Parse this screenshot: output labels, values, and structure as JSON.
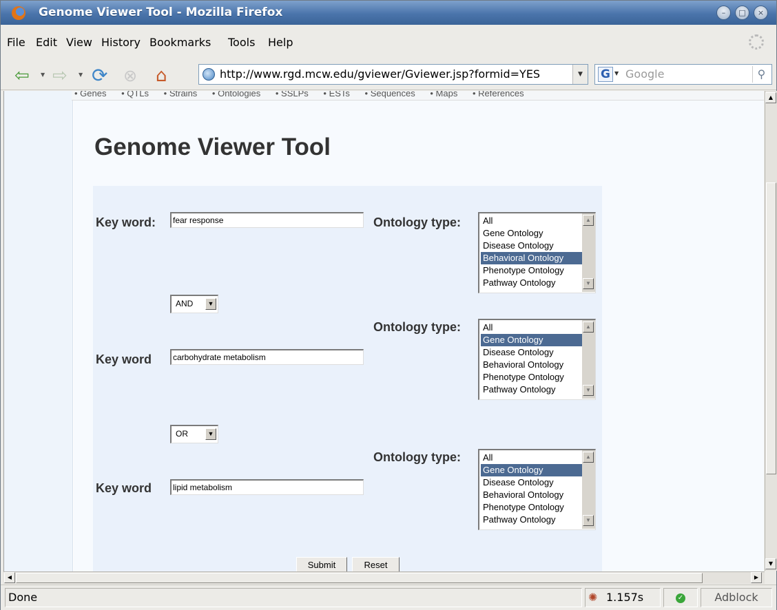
{
  "window": {
    "title": "Genome Viewer Tool - Mozilla Firefox"
  },
  "menu": {
    "items": [
      "File",
      "Edit",
      "View",
      "History",
      "Bookmarks",
      "Tools",
      "Help"
    ]
  },
  "navbar": {
    "url": "http://www.rgd.mcw.edu/gviewer/Gviewer.jsp?formid=YES",
    "search_engine_letter": "G",
    "search_placeholder": "Google"
  },
  "site_nav": {
    "links": [
      "• Genes",
      "• QTLs",
      "• Strains",
      "• Ontologies",
      "• SSLPs",
      "• ESTs",
      "• Sequences",
      "• Maps",
      "• References"
    ]
  },
  "page": {
    "title": "Genome Viewer Tool"
  },
  "form": {
    "rows": [
      {
        "keyword_label": "Key word:",
        "keyword_value": "fear response",
        "ontology_label": "Ontology type:",
        "ontology_options": [
          "All",
          "Gene Ontology",
          "Disease Ontology",
          "Behavioral Ontology",
          "Phenotype Ontology",
          "Pathway Ontology"
        ],
        "ontology_selected": "Behavioral Ontology"
      },
      {
        "operator": "AND",
        "keyword_label": "Key word",
        "keyword_value": "carbohydrate metabolism",
        "ontology_label": "Ontology type:",
        "ontology_options": [
          "All",
          "Gene Ontology",
          "Disease Ontology",
          "Behavioral Ontology",
          "Phenotype Ontology",
          "Pathway Ontology"
        ],
        "ontology_selected": "Gene Ontology"
      },
      {
        "operator": "OR",
        "keyword_label": "Key word",
        "keyword_value": "lipid metabolism",
        "ontology_label": "Ontology type:",
        "ontology_options": [
          "All",
          "Gene Ontology",
          "Disease Ontology",
          "Behavioral Ontology",
          "Phenotype Ontology",
          "Pathway Ontology"
        ],
        "ontology_selected": "Gene Ontology"
      }
    ],
    "submit_label": "Submit",
    "reset_label": "Reset"
  },
  "status": {
    "text": "Done",
    "load_time": "1.157s",
    "adblock_label": "Adblock"
  },
  "colors": {
    "titlebar": "#4a74ab",
    "selected_option": "#4c6a92",
    "form_panel": "#eaf1fb"
  }
}
